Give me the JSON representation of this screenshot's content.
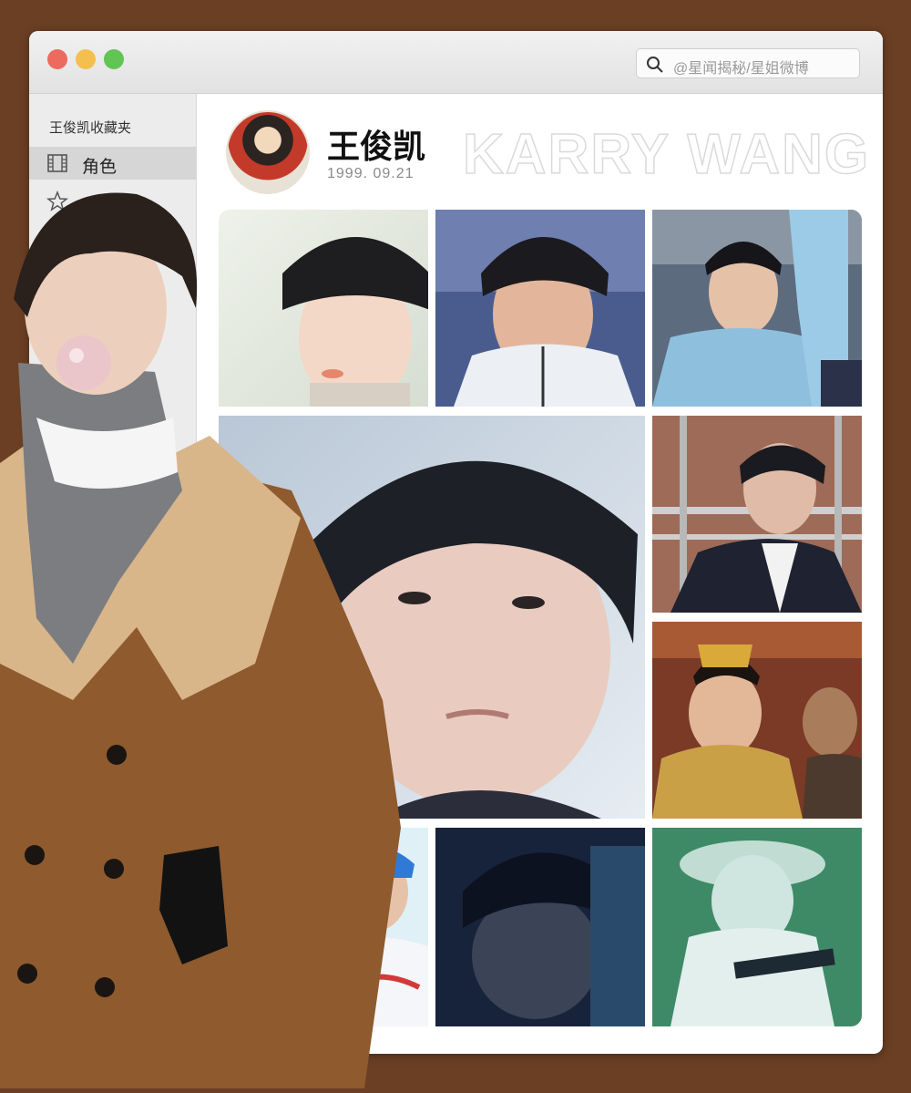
{
  "window": {
    "search_placeholder": "@星闻揭秘/星姐微博"
  },
  "sidebar": {
    "title": "王俊凯收藏夹",
    "items": [
      {
        "label": "角色",
        "icon": "film-icon",
        "active": true
      },
      {
        "label": "",
        "icon": "star-icon",
        "active": false
      }
    ]
  },
  "profile": {
    "name": "王俊凯",
    "birth_date": "1999. 09.21",
    "banner_text": "KARRY WANG"
  },
  "gallery": {
    "tiles": [
      {
        "name": "photo-tile-1",
        "subject": "portrait-bowl-cut"
      },
      {
        "name": "photo-tile-2",
        "subject": "portrait-white-jacket"
      },
      {
        "name": "photo-tile-3",
        "subject": "portrait-blue-hanfu"
      },
      {
        "name": "photo-tile-4",
        "subject": "closeup-face-featured"
      },
      {
        "name": "photo-tile-5",
        "subject": "portrait-suit"
      },
      {
        "name": "photo-tile-6",
        "subject": "portrait-golden-robe"
      },
      {
        "name": "photo-tile-7",
        "subject": "portrait-baseball"
      },
      {
        "name": "photo-tile-8",
        "subject": "portrait-dark"
      },
      {
        "name": "photo-tile-9",
        "subject": "portrait-beekeeper-suit"
      }
    ]
  },
  "colors": {
    "background": "#6b3f24",
    "window": "#ffffff",
    "sidebar": "#ececec",
    "sidebar_active": "#d6d6d6",
    "close": "#ed6a5e",
    "minimize": "#f5bf4f",
    "maximize": "#61c554"
  }
}
